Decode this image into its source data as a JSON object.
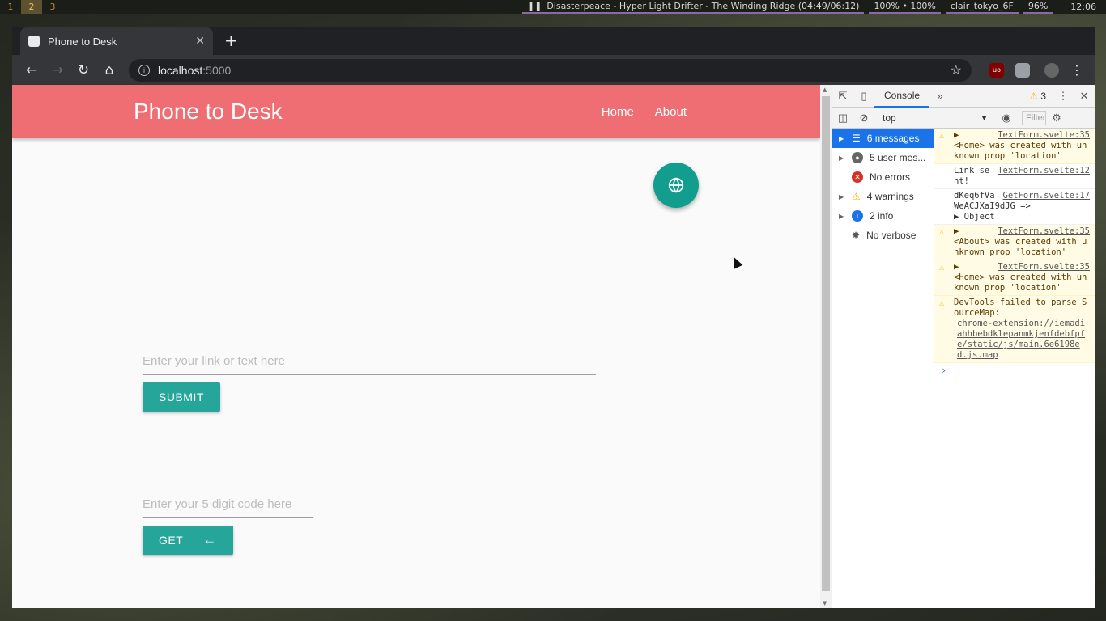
{
  "sysbar": {
    "workspaces": [
      "1",
      "2",
      "3"
    ],
    "now_playing": "Disasterpeace - Hyper Light Drifter - The Winding Ridge (04:49/06:12)",
    "volume": "100% • 100%",
    "wifi": "clair_tokyo_6F",
    "battery": "96%",
    "clock": "12:06"
  },
  "browser": {
    "tab_title": "Phone to Desk",
    "url_host": "localhost",
    "url_port": ":5000",
    "ublock_label": "uo"
  },
  "app": {
    "title": "Phone to Desk",
    "nav": [
      "Home",
      "About"
    ],
    "link_placeholder": "Enter your link or text here",
    "submit_label": "SUBMIT",
    "code_placeholder": "Enter your 5 digit code here",
    "get_label": "GET",
    "colors": {
      "header": "#ef6e73",
      "fab": "#129d8f",
      "button": "#26a69a"
    }
  },
  "devtools": {
    "tab": "Console",
    "warning_count": "3",
    "context": "top",
    "filter_placeholder": "Filter",
    "sidebar": [
      {
        "label": "6 messages",
        "icon": "list-icon"
      },
      {
        "label": "5 user mes...",
        "icon": "user-icon"
      },
      {
        "label": "No errors",
        "icon": "error-icon"
      },
      {
        "label": "4 warnings",
        "icon": "warning-icon"
      },
      {
        "label": "2 info",
        "icon": "info-icon"
      },
      {
        "label": "No verbose",
        "icon": "bug-icon"
      }
    ],
    "log": [
      {
        "src": "TextForm.svelte:35",
        "text": "<Home> was created with unknown prop 'location'"
      },
      {
        "src": "TextForm.svelte:12",
        "text": "Link sent!"
      },
      {
        "src": "GetForm.svelte:17",
        "text": "dKeq6fVaWeACJXaI9dJG  =>",
        "object": "▶ Object"
      },
      {
        "src": "TextForm.svelte:35",
        "text": "<About> was created with unknown prop 'location'"
      },
      {
        "src": "TextForm.svelte:35",
        "text": "<Home> was created with unknown prop 'location'"
      },
      {
        "src": "chrome-extension://iemadiahhbebdklepanmkjenfdebfpfe/static/js/main.6e6198ed.js.map",
        "text": "DevTools failed to parse SourceMap:"
      }
    ]
  }
}
